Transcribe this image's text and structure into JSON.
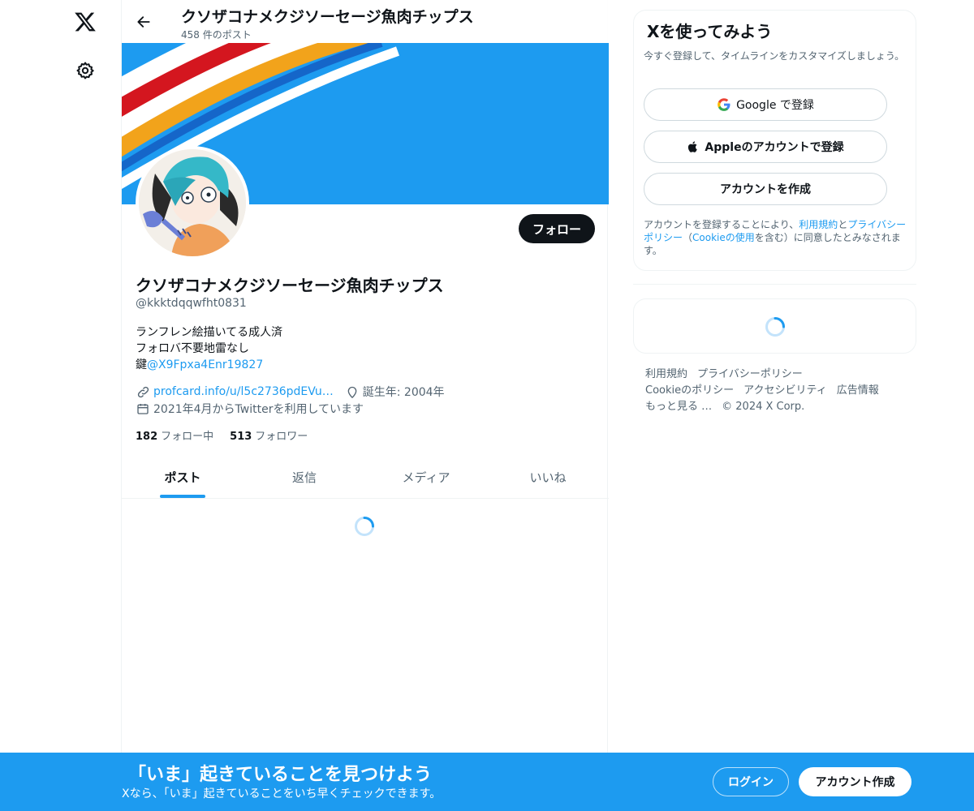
{
  "nav": {
    "logo_icon": "x-logo-icon",
    "settings_icon": "gear-icon"
  },
  "header": {
    "title": "クソザコナメクジソーセージ魚肉チップス",
    "post_count": "458 件のポスト"
  },
  "profile": {
    "display_name": "クソザコナメクジソーセージ魚肉チップス",
    "handle": "@kkktdqqwfht0831",
    "bio_line1": "ランフレン絵描いてる成人済",
    "bio_line2": "フォロバ不要地雷なし",
    "bio_line3_prefix": "鍵",
    "bio_line3_mention": "@X9Fpxa4Enr19827",
    "website": "profcard.info/u/l5c2736pdEVu…",
    "birth": "誕生年: 2004年",
    "joined": "2021年4月からTwitterを利用しています",
    "following_count": "182",
    "following_label": "フォロー中",
    "followers_count": "513",
    "followers_label": "フォロワー",
    "follow_button": "フォロー",
    "banner_color": "#1d9bf0"
  },
  "tabs": [
    "ポスト",
    "返信",
    "メディア",
    "いいね"
  ],
  "active_tab": "ポスト",
  "sidebar": {
    "join_title": "Xを使ってみよう",
    "join_sub": "今すぐ登録して、タイムラインをカスタマイズしましょう。",
    "google_btn": "Google で登録",
    "apple_btn": "Appleのアカウントで登録",
    "create_btn": "アカウントを作成",
    "terms_prefix": "アカウントを登録することにより、",
    "terms_link1": "利用規約",
    "terms_mid1": "と",
    "terms_link2": "プライバシーポリシー",
    "terms_mid2": "（",
    "terms_link3": "Cookieの使用",
    "terms_suffix": "を含む）に同意したとみなされます。"
  },
  "footer": {
    "links": [
      "利用規約",
      "プライバシーポリシー",
      "Cookieのポリシー",
      "アクセシビリティ",
      "広告情報",
      "もっと見る …"
    ],
    "copyright": "© 2024 X Corp."
  },
  "bottom_bar": {
    "title": "「いま」起きていることを見つけよう",
    "subtitle": "Xなら、「いま」起きていることをいち早くチェックできます。",
    "login": "ログイン",
    "signup": "アカウント作成"
  },
  "colors": {
    "accent": "#1d9bf0",
    "text": "#0f1419",
    "muted": "#536471"
  }
}
